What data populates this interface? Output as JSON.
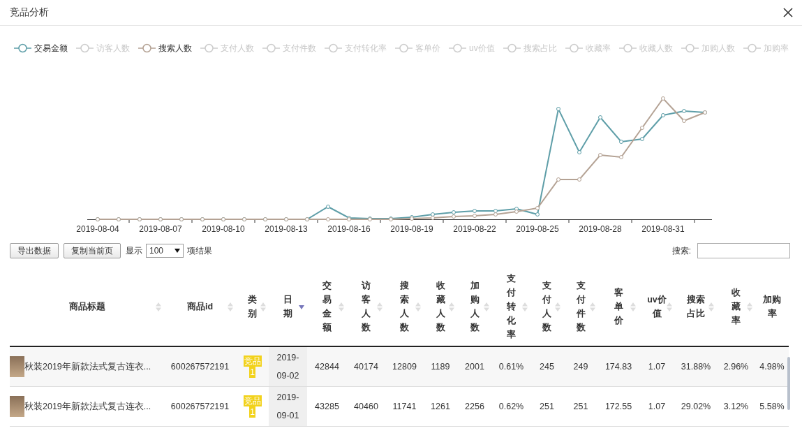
{
  "window": {
    "title": "竞品分析"
  },
  "legend": [
    {
      "label": "交易金额",
      "active": true,
      "color": "#5e9ea8"
    },
    {
      "label": "访客人数",
      "active": false
    },
    {
      "label": "搜索人数",
      "active": true,
      "color": "#b4a294"
    },
    {
      "label": "支付人数",
      "active": false
    },
    {
      "label": "支付件数",
      "active": false
    },
    {
      "label": "支付转化率",
      "active": false
    },
    {
      "label": "客单价",
      "active": false
    },
    {
      "label": "uv价值",
      "active": false
    },
    {
      "label": "搜索占比",
      "active": false
    },
    {
      "label": "收藏率",
      "active": false
    },
    {
      "label": "收藏人数",
      "active": false
    },
    {
      "label": "加购人数",
      "active": false
    },
    {
      "label": "加购率",
      "active": false
    }
  ],
  "chart": {
    "x_labels": [
      "2019-08-04",
      "2019-08-07",
      "2019-08-10",
      "2019-08-13",
      "2019-08-16",
      "2019-08-19",
      "2019-08-22",
      "2019-08-25",
      "2019-08-28",
      "2019-08-31"
    ]
  },
  "toolbar": {
    "buttons": [
      "导出数据",
      "复制当前页"
    ],
    "show_label": "显示",
    "page_size": "100",
    "results_label": "项结果",
    "search_label": "搜索:"
  },
  "table": {
    "columns": [
      {
        "label": "商品标题",
        "sorted": false
      },
      {
        "label": "商品id",
        "sorted": false
      },
      {
        "label": "类别",
        "sorted": false
      },
      {
        "label": "日期",
        "sorted": true
      },
      {
        "label": "交易金额",
        "sorted": false
      },
      {
        "label": "访客人数",
        "sorted": false
      },
      {
        "label": "搜索人数",
        "sorted": false
      },
      {
        "label": "收藏人数",
        "sorted": false
      },
      {
        "label": "加购人数",
        "sorted": false
      },
      {
        "label": "支付转化率",
        "sorted": false
      },
      {
        "label": "支付人数",
        "sorted": false
      },
      {
        "label": "支付件数",
        "sorted": false
      },
      {
        "label": "客单价",
        "sorted": false
      },
      {
        "label": "uv价值",
        "sorted": false
      },
      {
        "label": "搜索占比",
        "sorted": false
      },
      {
        "label": "收藏率",
        "sorted": false
      },
      {
        "label": "加购率"
      }
    ],
    "rows": [
      {
        "title": "秋装2019年新款法式复古连衣...",
        "id": "600267572191",
        "category": [
          "竞品",
          "1"
        ],
        "date": "2019-09-02",
        "values": [
          "42844",
          "40174",
          "12809",
          "1189",
          "2001",
          "0.61%",
          "245",
          "249",
          "174.83",
          "1.07",
          "31.88%",
          "2.96%",
          "4.98%"
        ]
      },
      {
        "title": "秋装2019年新款法式复古连衣...",
        "id": "600267572191",
        "category": [
          "竞品",
          "1"
        ],
        "date": "2019-09-01",
        "values": [
          "43285",
          "40460",
          "11741",
          "1261",
          "2256",
          "0.62%",
          "251",
          "251",
          "172.55",
          "1.07",
          "29.02%",
          "3.12%",
          "5.58%"
        ]
      }
    ]
  }
}
